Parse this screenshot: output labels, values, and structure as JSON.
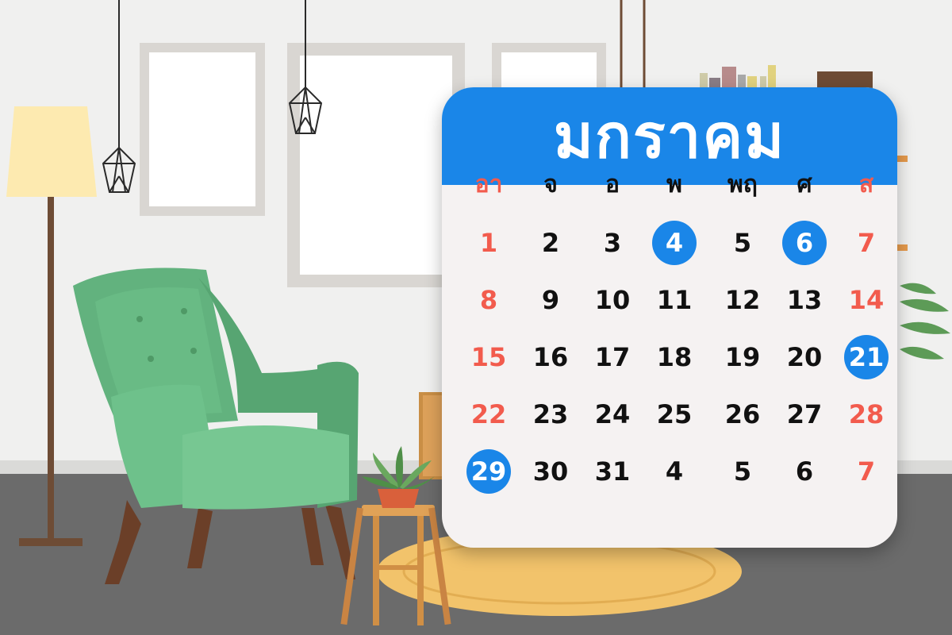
{
  "calendar": {
    "month": "มกราคม",
    "weekdays": [
      "อา",
      "จ",
      "อ",
      "พ",
      "พฤ",
      "ศ",
      "ส"
    ],
    "weeks": [
      [
        "1",
        "2",
        "3",
        "4",
        "5",
        "6",
        "7"
      ],
      [
        "8",
        "9",
        "10",
        "11",
        "12",
        "13",
        "14"
      ],
      [
        "15",
        "16",
        "17",
        "18",
        "19",
        "20",
        "21"
      ],
      [
        "22",
        "23",
        "24",
        "25",
        "26",
        "27",
        "28"
      ],
      [
        "29",
        "30",
        "31",
        "4",
        "5",
        "6",
        "7"
      ]
    ],
    "highlighted_dates": [
      "4",
      "6",
      "21",
      "29"
    ]
  },
  "colors": {
    "header_blue": "#1a86e8",
    "weekend_red": "#f25b4d",
    "sofa_green": "#62b27e",
    "wall": "#f0f0ef",
    "floor": "#6b6b6b",
    "rug": "#f2c36b"
  }
}
